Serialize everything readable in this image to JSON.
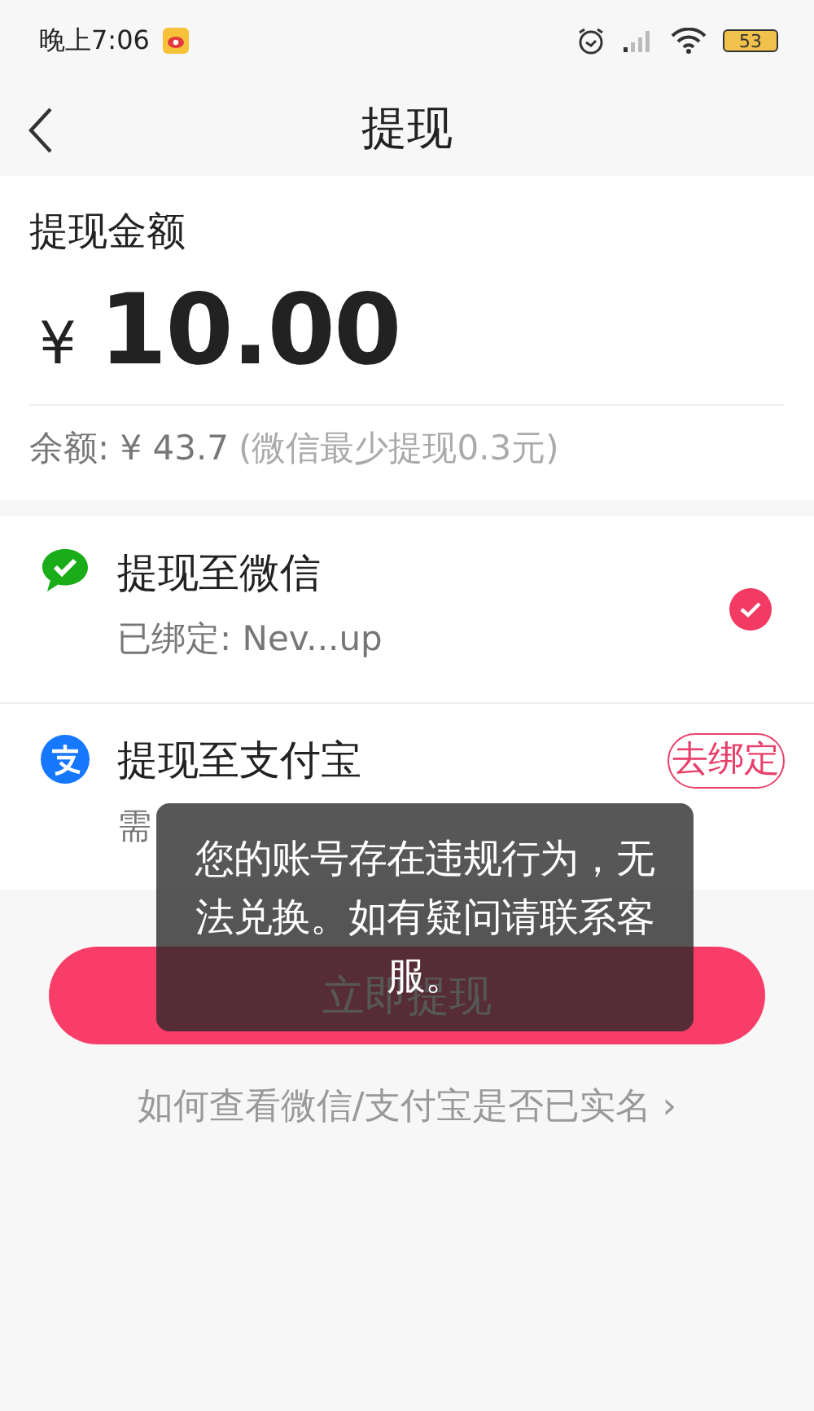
{
  "status_bar": {
    "time": "晚上7:06",
    "battery": "53"
  },
  "header": {
    "title": "提现"
  },
  "amount": {
    "label": "提现金额",
    "currency": "¥",
    "value": "10.00",
    "balance_label": "余额: ¥ 43.7",
    "balance_note": "(微信最少提现0.3元)"
  },
  "methods": [
    {
      "kind": "wechat",
      "title": "提现至微信",
      "subtitle": "已绑定: Nev...up",
      "selected": true
    },
    {
      "kind": "alipay",
      "title": "提现至支付宝",
      "subtitle": "需",
      "selected": false,
      "action": "去绑定"
    }
  ],
  "submit": "立即提现",
  "help_link": "如何查看微信/支付宝是否已实名",
  "help_chevron": "›",
  "toast": "您的账号存在违规行为，无法兑换。如有疑问请联系客服。"
}
